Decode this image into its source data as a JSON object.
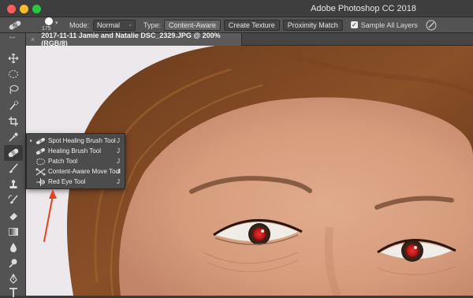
{
  "window": {
    "app_title": "Adobe Photoshop CC 2018",
    "traffic_lights": [
      "close",
      "minimize",
      "zoom"
    ]
  },
  "options_bar": {
    "active_tool_icon": "spot-healing-brush-icon",
    "brush_size": "175",
    "mode_label": "Mode:",
    "mode_value": "Normal",
    "type_label": "Type:",
    "type_options": [
      "Content-Aware",
      "Create Texture",
      "Proximity Match"
    ],
    "type_selected": "Content-Aware",
    "sample_all_layers_label": "Sample All Layers",
    "sample_all_layers_checked": true,
    "pressure_icon": "pressure-icon"
  },
  "document": {
    "tab_title": "2017-11-11 Jamie and Natalie DSC_2329.JPG @ 200% (RGB/8)",
    "close_glyph": "×"
  },
  "toolbar": {
    "tools": [
      {
        "name": "move-tool",
        "icon": "move-icon"
      },
      {
        "name": "marquee-tool",
        "icon": "marquee-icon"
      },
      {
        "name": "lasso-tool",
        "icon": "lasso-icon"
      },
      {
        "name": "quick-select-tool",
        "icon": "quick-select-icon"
      },
      {
        "name": "crop-tool",
        "icon": "crop-icon"
      },
      {
        "name": "eyedropper-tool",
        "icon": "eyedropper-icon"
      },
      {
        "name": "healing-tool",
        "icon": "bandage-icon",
        "selected": true
      },
      {
        "name": "brush-tool",
        "icon": "brush-icon"
      },
      {
        "name": "clone-stamp-tool",
        "icon": "stamp-icon"
      },
      {
        "name": "history-brush-tool",
        "icon": "history-brush-icon"
      },
      {
        "name": "eraser-tool",
        "icon": "eraser-icon"
      },
      {
        "name": "gradient-tool",
        "icon": "gradient-icon"
      },
      {
        "name": "blur-tool",
        "icon": "blur-drop-icon"
      },
      {
        "name": "dodge-tool",
        "icon": "dodge-icon"
      },
      {
        "name": "pen-tool",
        "icon": "pen-icon"
      },
      {
        "name": "type-tool",
        "icon": "type-icon"
      },
      {
        "name": "path-select-tool",
        "icon": "path-select-icon"
      }
    ]
  },
  "flyout": {
    "items": [
      {
        "label": "Spot Healing Brush Tool",
        "shortcut": "J",
        "icon": "spot-healing-brush-icon",
        "active": true
      },
      {
        "label": "Healing Brush Tool",
        "shortcut": "J",
        "icon": "healing-brush-icon",
        "active": false
      },
      {
        "label": "Patch Tool",
        "shortcut": "J",
        "icon": "patch-icon",
        "active": false
      },
      {
        "label": "Content-Aware Move Tool",
        "shortcut": "J",
        "icon": "content-aware-move-icon",
        "active": false
      },
      {
        "label": "Red Eye Tool",
        "shortcut": "J",
        "icon": "red-eye-icon",
        "active": false
      }
    ],
    "active_bullet": "▪"
  },
  "colors": {
    "annotation_arrow": "#e8401c",
    "red_eye": "#d21f1f"
  }
}
